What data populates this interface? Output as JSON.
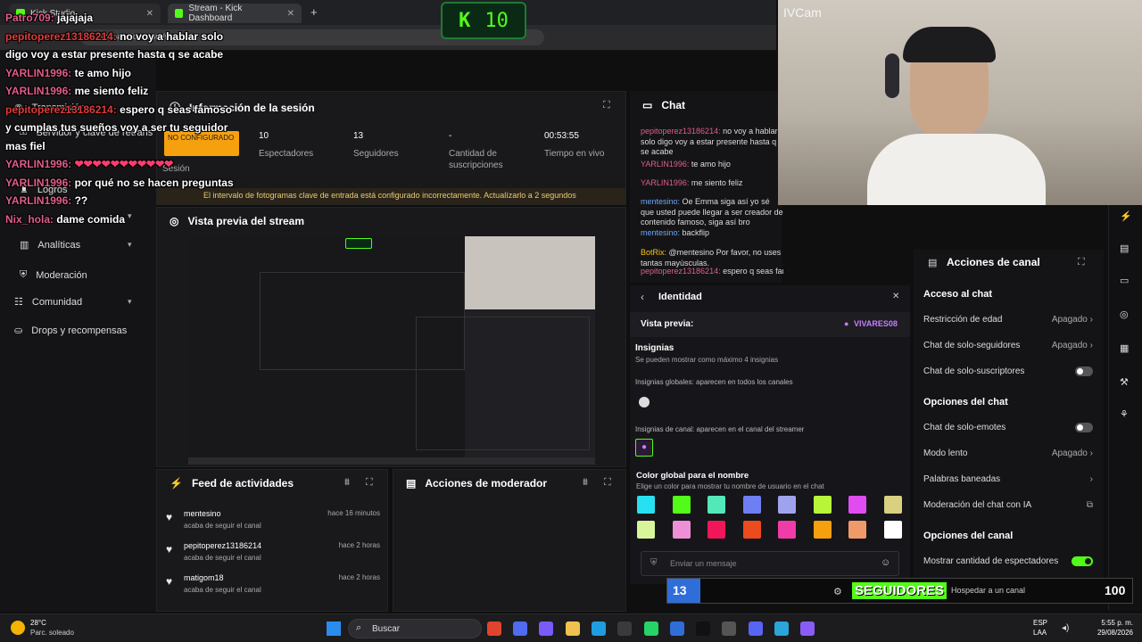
{
  "browser": {
    "tab1": "Kick Studio",
    "tab2": "Stream - Kick Dashboard",
    "new_tab": "+",
    "url": "dashboard.kick.com/stream"
  },
  "counter_badge": {
    "k": "K",
    "value": "10"
  },
  "webcam_label": "IVCam",
  "sidebar": {
    "items": [
      {
        "label": "Transmisión"
      },
      {
        "label": "Servidor y clave de retrans"
      },
      {
        "label": "Logros"
      },
      {
        "label": "Moderación"
      },
      {
        "label": "Analíticas"
      },
      {
        "label": "Comunidad"
      },
      {
        "label": "Drops y recompensas"
      }
    ],
    "config_badge": "NO CONFIGURADO",
    "sesion_label": "Sesión"
  },
  "session": {
    "title": "Información de la sesión",
    "stats": [
      {
        "value": "10",
        "label": "Espectadores"
      },
      {
        "value": "13",
        "label": "Seguidores"
      },
      {
        "value": "-",
        "label": "Cantidad de suscripciones"
      },
      {
        "value": "00:53:55",
        "label": "Tiempo en vivo"
      }
    ],
    "warning": "El intervalo de fotogramas clave de entrada está configurado incorrectamente. Actualízarlo a 2 segundos"
  },
  "preview": {
    "title": "Vista previa del stream"
  },
  "feed": {
    "title": "Feed de actividades",
    "items": [
      {
        "name": "mentesino",
        "desc": "acaba de seguir el canal",
        "time": "hace 16 minutos"
      },
      {
        "name": "pepitoperez13186214",
        "desc": "acaba de seguir el canal",
        "time": "hace 2 horas"
      },
      {
        "name": "matigom18",
        "desc": "acaba de seguir el canal",
        "time": "hace 2 horas"
      }
    ]
  },
  "mod_actions": {
    "title": "Acciones de moderador"
  },
  "overlay_chat": [
    {
      "user": "Patro709:",
      "msg": " jajajaja",
      "color": "#e25d8a"
    },
    {
      "user": "pepitoperez13186214:",
      "msg": " no voy a hablar solo digo voy a estar presente hasta q se acabe",
      "color": "#e03b3b"
    },
    {
      "user": "YARLIN1996:",
      "msg": " te amo hijo",
      "color": "#e25d8a"
    },
    {
      "user": "YARLIN1996:",
      "msg": " me siento feliz",
      "color": "#e25d8a"
    },
    {
      "user": "pepitoperez13186214:",
      "msg": " espero q seas famoso y cumplas tus sueños voy a ser tu seguidor mas fiel",
      "color": "#e03b3b"
    },
    {
      "user": "YARLIN1996:",
      "msg": " ❤❤❤❤❤❤❤❤❤❤❤",
      "color": "#e25d8a"
    },
    {
      "user": "YARLIN1996:",
      "msg": " por qué no se hacen preguntas",
      "color": "#e25d8a"
    },
    {
      "user": "YARLIN1996:",
      "msg": " ??",
      "color": "#e25d8a"
    },
    {
      "user": "Nix_hola:",
      "msg": " dame comida",
      "color": "#e25d8a"
    }
  ],
  "chat": {
    "title": "Chat",
    "messages": [
      {
        "user": "pepitoperez13186214:",
        "msg": " no voy a hablar solo digo voy a estar presente hasta q se acabe"
      },
      {
        "user": "YARLIN1996:",
        "msg": " te amo hijo"
      },
      {
        "user": "YARLIN1996:",
        "msg": " me siento feliz"
      },
      {
        "user": "mentesino:",
        "msg": " Oe Emma siga así yo sé que usted puede llegar a ser creador de contenido famoso, siga así bro"
      },
      {
        "user": "mentesino:",
        "msg": " backflip"
      },
      {
        "user": "BotRix:",
        "msg": " @mentesino Por favor, no uses tantas mayúsculas."
      },
      {
        "user": "pepitoperez13186214:",
        "msg": " espero q seas famoso y cumplas tus"
      }
    ],
    "send_placeholder": "Enviar un mensaje"
  },
  "identity": {
    "title": "Identidad",
    "preview_label": "Vista previa:",
    "preview_name": "VIVARES08",
    "badges_title": "Insignias",
    "badges_sub": "Se pueden mostrar como máximo 4 insignias",
    "global_badges": "Insignias globales: aparecen en todos los canales",
    "channel_badges": "Insignias de canal: aparecen en el canal del streamer",
    "color_title": "Color global para el nombre",
    "color_sub": "Elige un color para mostrar tu nombre de usuario en el chat",
    "colors": [
      "#27e0f0",
      "#53fc18",
      "#54e8b8",
      "#6e7ff5",
      "#9fa3ee",
      "#b8f53a",
      "#e04cf0",
      "#d9d080",
      "#d8f59c",
      "#ee8fd8",
      "#f0165a",
      "#ec4a1f",
      "#f03ca8",
      "#f5a00f",
      "#f09a6a",
      "#ffffff"
    ]
  },
  "channel_actions": {
    "title": "Acciones de canal",
    "sections": [
      {
        "heading": "Acceso al chat",
        "rows": [
          {
            "label": "Restricción de edad",
            "value": "Apagado"
          },
          {
            "label": "Chat de solo-seguidores",
            "value": "Apagado"
          },
          {
            "label": "Chat de solo-suscriptores",
            "value": ""
          }
        ]
      },
      {
        "heading": "Opciones del chat",
        "rows": [
          {
            "label": "Chat de solo-emotes",
            "value": ""
          },
          {
            "label": "Modo lento",
            "value": "Apagado"
          },
          {
            "label": "Palabras baneadas",
            "value": ""
          },
          {
            "label": "Moderación del chat con IA",
            "value": ""
          }
        ]
      },
      {
        "heading": "Opciones del canal",
        "rows": [
          {
            "label": "Mostrar cantidad de espectadores",
            "value": ""
          },
          {
            "label": "Hospedar a un canal",
            "value": ""
          }
        ]
      }
    ]
  },
  "follower_goal": {
    "current": "13",
    "label": "SEGUIDORES",
    "target": "100",
    "progress": 0.13
  },
  "taskbar": {
    "weather_temp": "28°C",
    "weather_desc": "Parc. soleado",
    "search": "Buscar",
    "lang": "ESP",
    "lang2": "LAA",
    "time": "5:55 p. m.",
    "date": "29/08/2026"
  }
}
